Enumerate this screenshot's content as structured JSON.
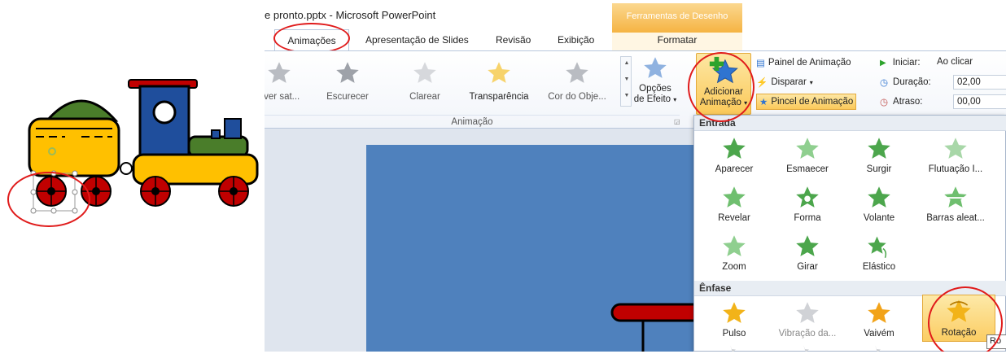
{
  "window": {
    "title": "e pronto.pptx - Microsoft PowerPoint",
    "context_group": "Ferramentas de Desenho"
  },
  "tabs": [
    {
      "label": "Animações",
      "active": true
    },
    {
      "label": "Apresentação de Slides"
    },
    {
      "label": "Revisão"
    },
    {
      "label": "Exibição"
    },
    {
      "label": "Formatar",
      "contextual": true
    }
  ],
  "ribbon": {
    "animation_gallery": [
      {
        "label": "over sat...",
        "icon": "star-icon"
      },
      {
        "label": "Escurecer",
        "icon": "star-icon"
      },
      {
        "label": "Clarear",
        "icon": "star-icon"
      },
      {
        "label": "Transparência",
        "icon": "star-icon"
      },
      {
        "label": "Cor do Obje...",
        "icon": "star-icon"
      }
    ],
    "effect_options": {
      "line1": "Opções",
      "line2": "de Efeito"
    },
    "group_label": "Animação",
    "add_animation": {
      "line1": "Adicionar",
      "line2": "Animação"
    },
    "advanced": {
      "panel": "Painel de Animação",
      "trigger": "Disparar",
      "painter": "Pincel de Animação"
    },
    "timing": {
      "start_label": "Iniciar:",
      "start_value": "Ao clicar",
      "duration_label": "Duração:",
      "duration_value": "02,00",
      "delay_label": "Atraso:",
      "delay_value": "00,00"
    }
  },
  "dropdown": {
    "entrada_header": "Entrada",
    "entrada": [
      "Aparecer",
      "Esmaecer",
      "Surgir",
      "Flutuação I...",
      "Revelar",
      "Forma",
      "Volante",
      "Barras aleat...",
      "Zoom",
      "Girar",
      "Elástico"
    ],
    "enfase_header": "Ênfase",
    "enfase": [
      "Pulso",
      "Vibração da...",
      "Vaivém",
      "Rotação"
    ],
    "tooltip": "Ro"
  },
  "colors": {
    "entrance_star": "#4ca64c",
    "emphasis_star": "#f2b319",
    "accent_red": "#e01b1b",
    "slide_blue": "#4f81bd"
  }
}
